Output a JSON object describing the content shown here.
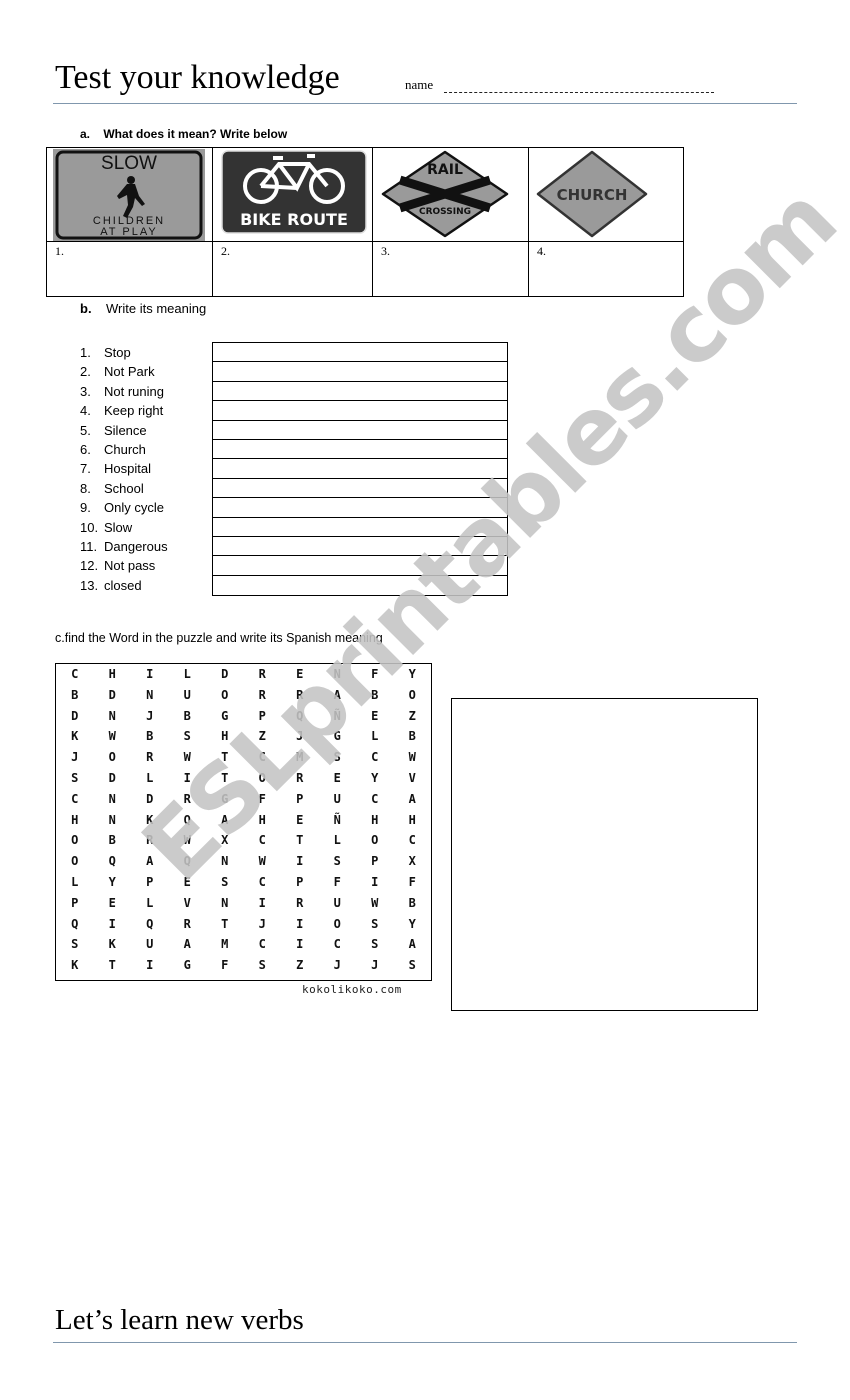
{
  "header": {
    "title": "Test your knowledge",
    "name_label": "name"
  },
  "section_a": {
    "marker": "a.",
    "instruction": "What does it  mean? Write below",
    "signs": [
      {
        "icon": "slow-children-at-play-sign",
        "lines": [
          "SLOW",
          "CHILDREN",
          "AT PLAY"
        ],
        "answer_num": "1."
      },
      {
        "icon": "bike-route-sign",
        "lines": [
          "BIKE ROUTE"
        ],
        "answer_num": "2."
      },
      {
        "icon": "rail-crossing-sign",
        "lines": [
          "RAIL",
          "CROSSING"
        ],
        "answer_num": "3."
      },
      {
        "icon": "church-sign",
        "lines": [
          "CHURCH"
        ],
        "answer_num": "4."
      }
    ]
  },
  "section_b": {
    "marker": "b.",
    "instruction": "Write its meaning",
    "items": [
      {
        "num": "1.",
        "text": "Stop"
      },
      {
        "num": "2.",
        "text": "Not Park"
      },
      {
        "num": "3.",
        "text": "Not runing"
      },
      {
        "num": "4.",
        "text": "Keep right"
      },
      {
        "num": "5.",
        "text": "Silence"
      },
      {
        "num": "6.",
        "text": "Church"
      },
      {
        "num": "7.",
        "text": "Hospital"
      },
      {
        "num": "8.",
        "text": "School"
      },
      {
        "num": "9.",
        "text": "Only cycle"
      },
      {
        "num": "10.",
        "text": "Slow"
      },
      {
        "num": "11.",
        "text": "Dangerous"
      },
      {
        "num": "12.",
        "text": "Not pass"
      },
      {
        "num": "13.",
        "text": "closed"
      }
    ]
  },
  "section_c": {
    "instruction": "c.find the Word in the puzzle and write its Spanish meaning",
    "puzzle_rows": [
      [
        "C",
        "H",
        "I",
        "L",
        "D",
        "R",
        "E",
        "N",
        "F",
        "Y"
      ],
      [
        "B",
        "D",
        "N",
        "U",
        "O",
        "R",
        "R",
        "A",
        "B",
        "O"
      ],
      [
        "D",
        "N",
        "J",
        "B",
        "G",
        "P",
        "Q",
        "Ñ",
        "E",
        "Z"
      ],
      [
        "K",
        "W",
        "B",
        "S",
        "H",
        "Z",
        "J",
        "G",
        "L",
        "B"
      ],
      [
        "J",
        "O",
        "R",
        "W",
        "T",
        "C",
        "M",
        "S",
        "C",
        "W"
      ],
      [
        "S",
        "D",
        "L",
        "I",
        "T",
        "O",
        "R",
        "E",
        "Y",
        "V"
      ],
      [
        "C",
        "N",
        "D",
        "R",
        "G",
        "F",
        "P",
        "U",
        "C",
        "A"
      ],
      [
        "H",
        "N",
        "K",
        "Q",
        "A",
        "H",
        "E",
        "Ñ",
        "H",
        "H"
      ],
      [
        "O",
        "B",
        "R",
        "W",
        "X",
        "C",
        "T",
        "L",
        "O",
        "C"
      ],
      [
        "O",
        "Q",
        "A",
        "Q",
        "N",
        "W",
        "I",
        "S",
        "P",
        "X"
      ],
      [
        "L",
        "Y",
        "P",
        "E",
        "S",
        "C",
        "P",
        "F",
        "I",
        "F"
      ],
      [
        "P",
        "E",
        "L",
        "V",
        "N",
        "I",
        "R",
        "U",
        "W",
        "B"
      ],
      [
        "Q",
        "I",
        "Q",
        "R",
        "T",
        "J",
        "I",
        "O",
        "S",
        "Y"
      ],
      [
        "S",
        "K",
        "U",
        "A",
        "M",
        "C",
        "I",
        "C",
        "S",
        "A"
      ],
      [
        "K",
        "T",
        "I",
        "G",
        "F",
        "S",
        "Z",
        "J",
        "J",
        "S"
      ]
    ],
    "credit": "kokolikoko.com"
  },
  "footer": {
    "title": "Let’s learn new verbs"
  },
  "watermark": "ESLprintables.com",
  "colors": {
    "rule": "#8097ad",
    "sign_gray": "#9a9a9a",
    "sign_dark": "#333333",
    "watermark": "#c4c4c4"
  }
}
